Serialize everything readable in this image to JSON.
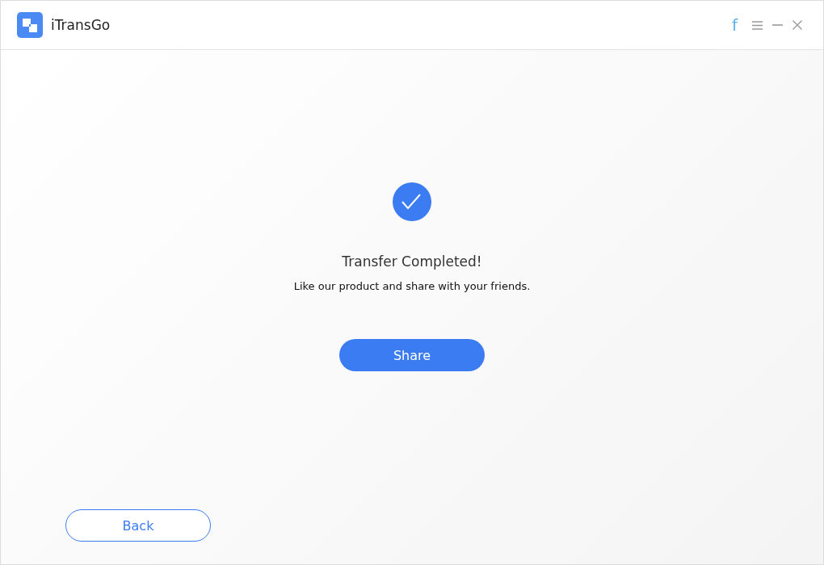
{
  "window": {
    "title": "iTransGo",
    "facebook": "f"
  },
  "result": {
    "title": "Transfer Completed!",
    "message": "Like our product and share with your friends."
  },
  "buttons": {
    "share": "Share",
    "back": "Back"
  }
}
